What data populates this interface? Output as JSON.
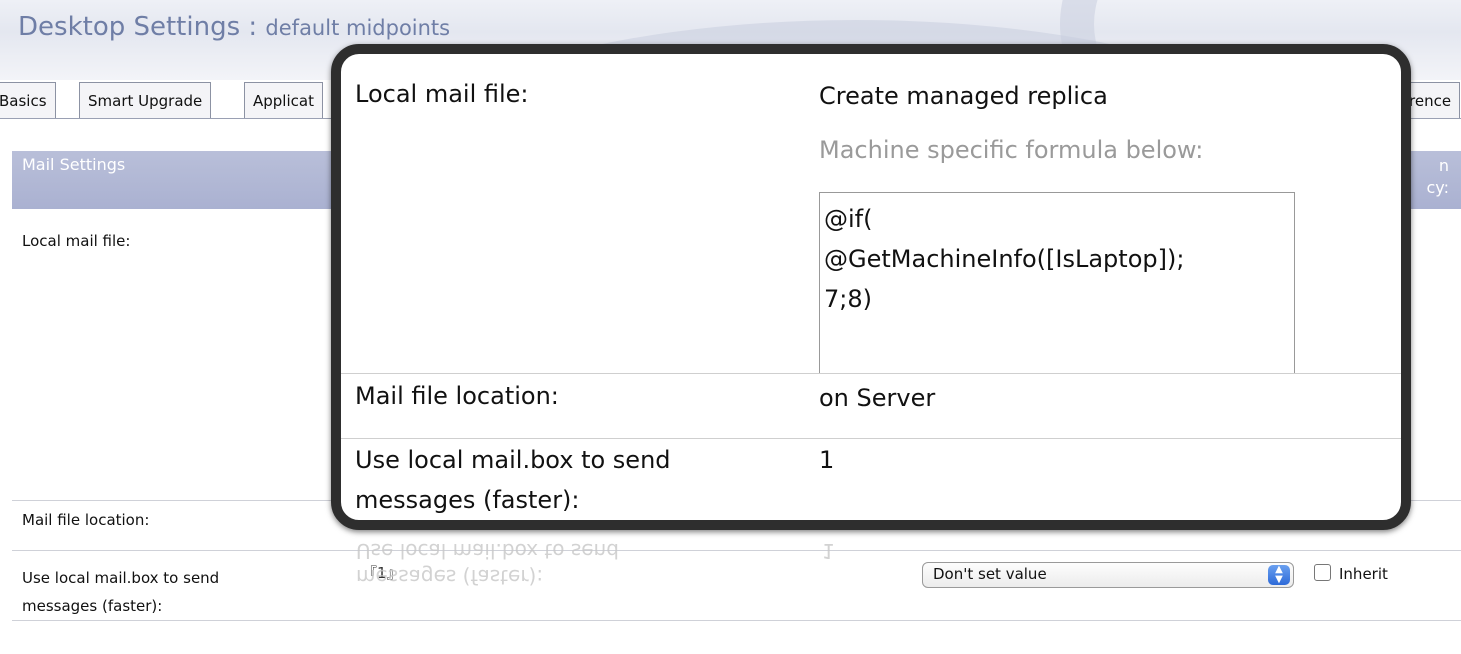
{
  "page": {
    "title": "Desktop Settings : ",
    "subtitle": "default midpoints"
  },
  "tabs": [
    "Basics",
    "Smart Upgrade",
    "Applicat",
    "rence"
  ],
  "section": {
    "header": "Mail Settings",
    "right_header": "n\ncy:"
  },
  "background_rows": {
    "local_mail_file": "Local mail file:",
    "mail_file_location": "Mail file location:",
    "use_local_mailbox": "Use local mail.box to send\nmessages (faster):",
    "mailbox_value": "『1』",
    "select_value": "Don't set value",
    "inherit_label": "Inherit"
  },
  "reflection": {
    "line1": "messages (faster):",
    "line2": "Use local mail.box to send",
    "value": "1"
  },
  "callout": {
    "local_mail_file_label": "Local mail file:",
    "local_mail_file_value": "Create managed replica",
    "formula_hint": "Machine specific formula below:",
    "formula": "@if(\n@GetMachineInfo([IsLaptop]);\n7;8)",
    "mail_file_location_label": "Mail file location:",
    "mail_file_location_value": "on Server",
    "use_local_mailbox_label": "Use local mail.box to send\nmessages (faster):",
    "use_local_mailbox_value": "1"
  }
}
